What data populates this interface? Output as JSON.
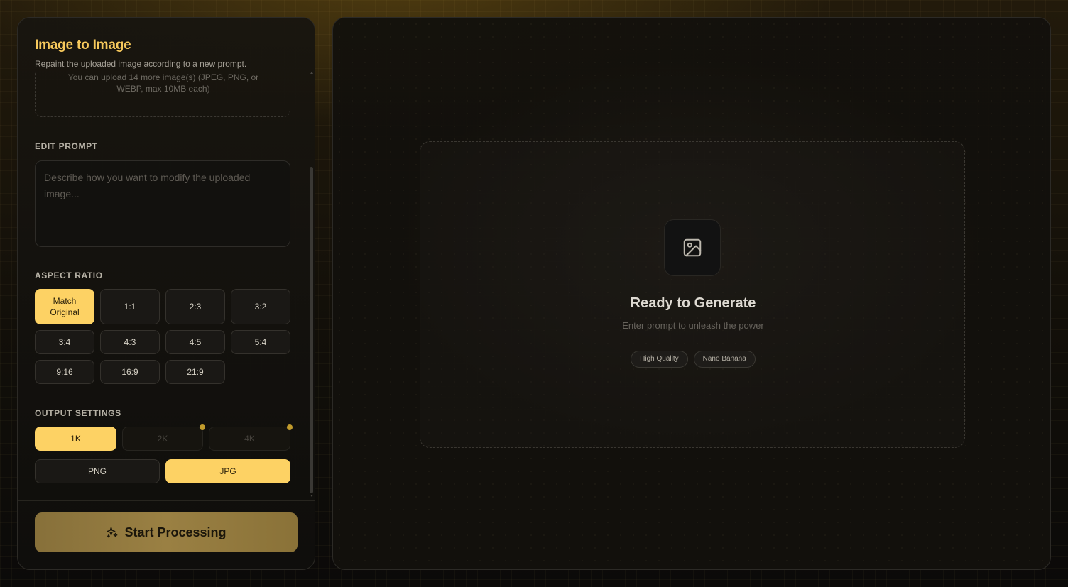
{
  "panel": {
    "title": "Image to Image",
    "description": "Repaint the uploaded image according to a new prompt.",
    "upload_hint": "You can upload 14 more image(s) (JPEG, PNG, or WEBP, max 10MB each)"
  },
  "prompt": {
    "label": "EDIT PROMPT",
    "placeholder": "Describe how you want to modify the uploaded image...",
    "value": ""
  },
  "aspect_ratio": {
    "label": "ASPECT RATIO",
    "selected": "Match Original",
    "options": [
      "Match Original",
      "1:1",
      "2:3",
      "3:2",
      "3:4",
      "4:3",
      "4:5",
      "5:4",
      "9:16",
      "16:9",
      "21:9"
    ]
  },
  "output_settings": {
    "label": "OUTPUT SETTINGS",
    "resolutions": [
      "1K",
      "2K",
      "4K"
    ],
    "selected_resolution": "1K",
    "formats": [
      "PNG",
      "JPG"
    ],
    "selected_format": "JPG"
  },
  "start_button": {
    "label": "Start Processing"
  },
  "preview": {
    "title": "Ready to Generate",
    "subtitle": "Enter prompt to unleash the power",
    "tags": [
      "High Quality",
      "Nano Banana"
    ]
  },
  "colors": {
    "accent": "#fdd264",
    "title": "#f7c95c",
    "start_button": "#9a8043"
  },
  "icons": {
    "start_button": "sparkles-icon",
    "preview": "image-icon"
  }
}
